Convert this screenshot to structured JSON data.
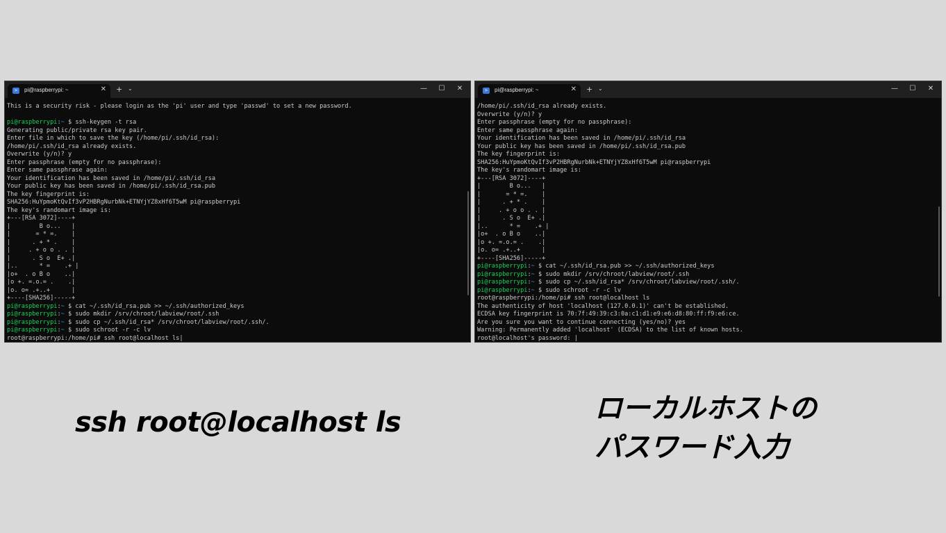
{
  "left_window": {
    "tab_title": "pi@raspberrypi: ~",
    "lines": [
      "This is a security risk - please login as the 'pi' user and type 'passwd' to set a new password.",
      "",
      {
        "prompt": "pi@raspberrypi",
        "path": "~",
        "cmd": "ssh-keygen -t rsa"
      },
      "Generating public/private rsa key pair.",
      "Enter file in which to save the key (/home/pi/.ssh/id_rsa):",
      "/home/pi/.ssh/id_rsa already exists.",
      "Overwrite (y/n)? y",
      "Enter passphrase (empty for no passphrase):",
      "Enter same passphrase again:",
      "Your identification has been saved in /home/pi/.ssh/id_rsa",
      "Your public key has been saved in /home/pi/.ssh/id_rsa.pub",
      "The key fingerprint is:",
      "SHA256:HuYpmoKtQvIf3vP2HBRgNurbNk+ETNYjYZ8xHf6T5wM pi@raspberrypi",
      "The key's randomart image is:",
      "+---[RSA 3072]----+",
      "|        B o...   |",
      "|       = * =.    |",
      "|      . + * .    |",
      "|     . + o o . . |",
      "|      . S o  E+ .|",
      "|..      * =    .+ |",
      "|o+  . o B o    ..|",
      "|o +. =.o.= .    .|",
      "|o. o= .+..+      |",
      "+----[SHA256]-----+",
      {
        "prompt": "pi@raspberrypi",
        "path": "~",
        "cmd": "cat ~/.ssh/id_rsa.pub >> ~/.ssh/authorized_keys"
      },
      {
        "prompt": "pi@raspberrypi",
        "path": "~",
        "cmd": "sudo mkdir /srv/chroot/labview/root/.ssh"
      },
      {
        "prompt": "pi@raspberrypi",
        "path": "~",
        "cmd": "sudo cp ~/.ssh/id_rsa* /srv/chroot/labview/root/.ssh/."
      },
      {
        "prompt": "pi@raspberrypi",
        "path": "~",
        "cmd": "sudo schroot -r -c lv"
      },
      {
        "text": "root@raspberrypi:/home/pi# ssh root@localhost ls",
        "cursor": true
      }
    ]
  },
  "right_window": {
    "tab_title": "pi@raspberrypi: ~",
    "lines": [
      "/home/pi/.ssh/id_rsa already exists.",
      "Overwrite (y/n)? y",
      "Enter passphrase (empty for no passphrase):",
      "Enter same passphrase again:",
      "Your identification has been saved in /home/pi/.ssh/id_rsa",
      "Your public key has been saved in /home/pi/.ssh/id_rsa.pub",
      "The key fingerprint is:",
      "SHA256:HuYpmoKtQvIf3vP2HBRgNurbNk+ETNYjYZ8xHf6T5wM pi@raspberrypi",
      "The key's randomart image is:",
      "+---[RSA 3072]----+",
      "|        B o...   |",
      "|       = * =.    |",
      "|      . + * .    |",
      "|     . + o o . . |",
      "|      . S o  E+ .|",
      "|..      * =    .+ |",
      "|o+  . o B o    ..|",
      "|o +. =.o.= .    .|",
      "|o. o= .+..+      |",
      "+----[SHA256]-----+",
      {
        "prompt": "pi@raspberrypi",
        "path": "~",
        "cmd": "cat ~/.ssh/id_rsa.pub >> ~/.ssh/authorized_keys"
      },
      {
        "prompt": "pi@raspberrypi",
        "path": "~",
        "cmd": "sudo mkdir /srv/chroot/labview/root/.ssh"
      },
      {
        "prompt": "pi@raspberrypi",
        "path": "~",
        "cmd": "sudo cp ~/.ssh/id_rsa* /srv/chroot/labview/root/.ssh/."
      },
      {
        "prompt": "pi@raspberrypi",
        "path": "~",
        "cmd": "sudo schroot -r -c lv"
      },
      "root@raspberrypi:/home/pi# ssh root@localhost ls",
      "The authenticity of host 'localhost (127.0.0.1)' can't be established.",
      "ECDSA key fingerprint is 70:7f:49:39:c3:0a:c1:d1:e9:e6:d8:80:ff:f9:e6:ce.",
      "Are you sure you want to continue connecting (yes/no)? yes",
      "Warning: Permanently added 'localhost' (ECDSA) to the list of known hosts.",
      {
        "text": "root@localhost's password: ",
        "cursor": true
      }
    ]
  },
  "window_controls": {
    "minimize": "—",
    "maximize": "☐",
    "close": "✕",
    "tab_close": "✕",
    "new_tab": "+",
    "dropdown": "⌄"
  },
  "captions": {
    "left": "ssh root@localhost ls",
    "right_line1": "ローカルホストの",
    "right_line2": "パスワード入力"
  },
  "colors": {
    "prompt_green": "#13d35a",
    "path_blue": "#3b8eea",
    "terminal_bg": "#0c0c0c"
  }
}
